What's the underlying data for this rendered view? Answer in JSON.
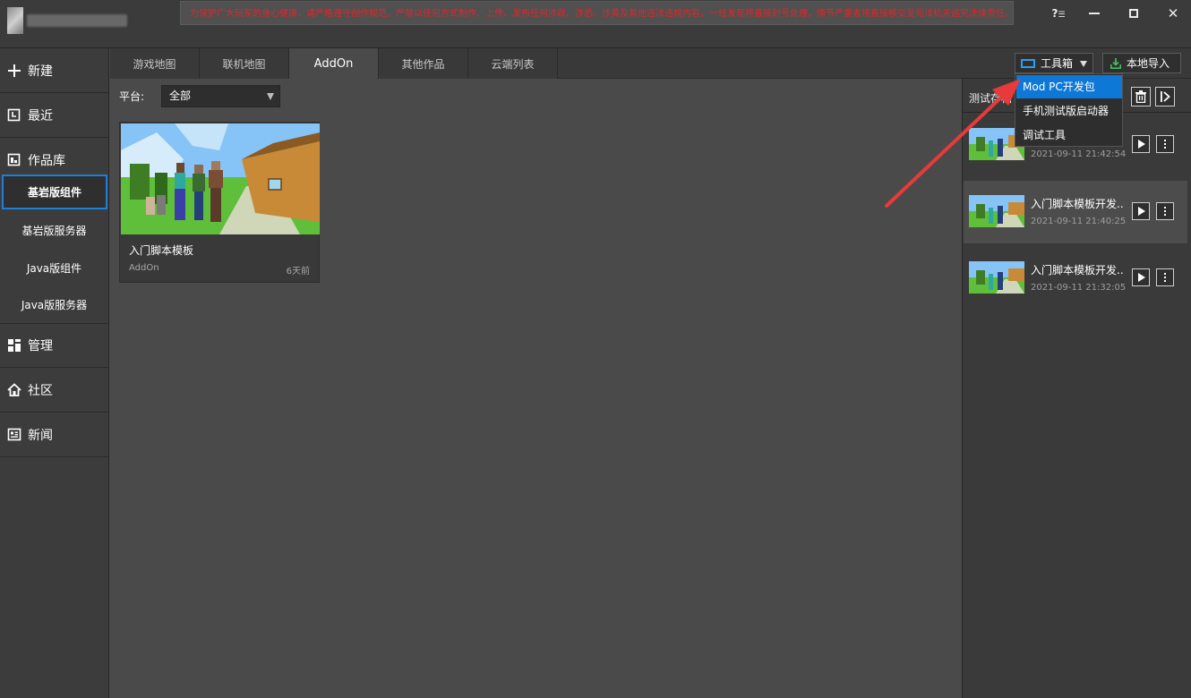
{
  "titlebar": {
    "notice": "为保护广大玩家的身心健康，请严格遵守创作规范，严禁以任何方式制作、上传、发布任何涉政、涉恐、涉黄及其他违法违规内容，一经发现将直接封号处理，情节严重者将直接移交至司法机关追究法律责任。",
    "help_label": "?",
    "close_label": "✕"
  },
  "sidebar": {
    "new": "新建",
    "recent": "最近",
    "library": "作品库",
    "sub_bedrock_addon": "基岩版组件",
    "sub_bedrock_server": "基岩版服务器",
    "sub_java_addon": "Java版组件",
    "sub_java_server": "Java版服务器",
    "manage": "管理",
    "community": "社区",
    "news": "新闻"
  },
  "tabs": [
    "游戏地图",
    "联机地图",
    "AddOn",
    "其他作品",
    "云端列表"
  ],
  "filter": {
    "label": "平台:",
    "value": "全部"
  },
  "card": {
    "title": "入门脚本模板",
    "type": "AddOn",
    "time": "6天前"
  },
  "toolbar": {
    "toolbox": "工具箱",
    "import": "本地导入"
  },
  "menu": [
    "Mod PC开发包",
    "手机测试版启动器",
    "调试工具"
  ],
  "rpanel": {
    "title": "测试存档",
    "items": [
      {
        "name": "",
        "time": "2021-09-11 21:42:54"
      },
      {
        "name": "入门脚本模板开发..",
        "time": "2021-09-11 21:40:25"
      },
      {
        "name": "入门脚本模板开发..",
        "time": "2021-09-11 21:32:05"
      }
    ]
  },
  "colors": {
    "accent": "#1e7fd8",
    "menu_selected": "#0e78d6",
    "notice_text": "#e0262a",
    "arrow": "#e83a3a"
  }
}
